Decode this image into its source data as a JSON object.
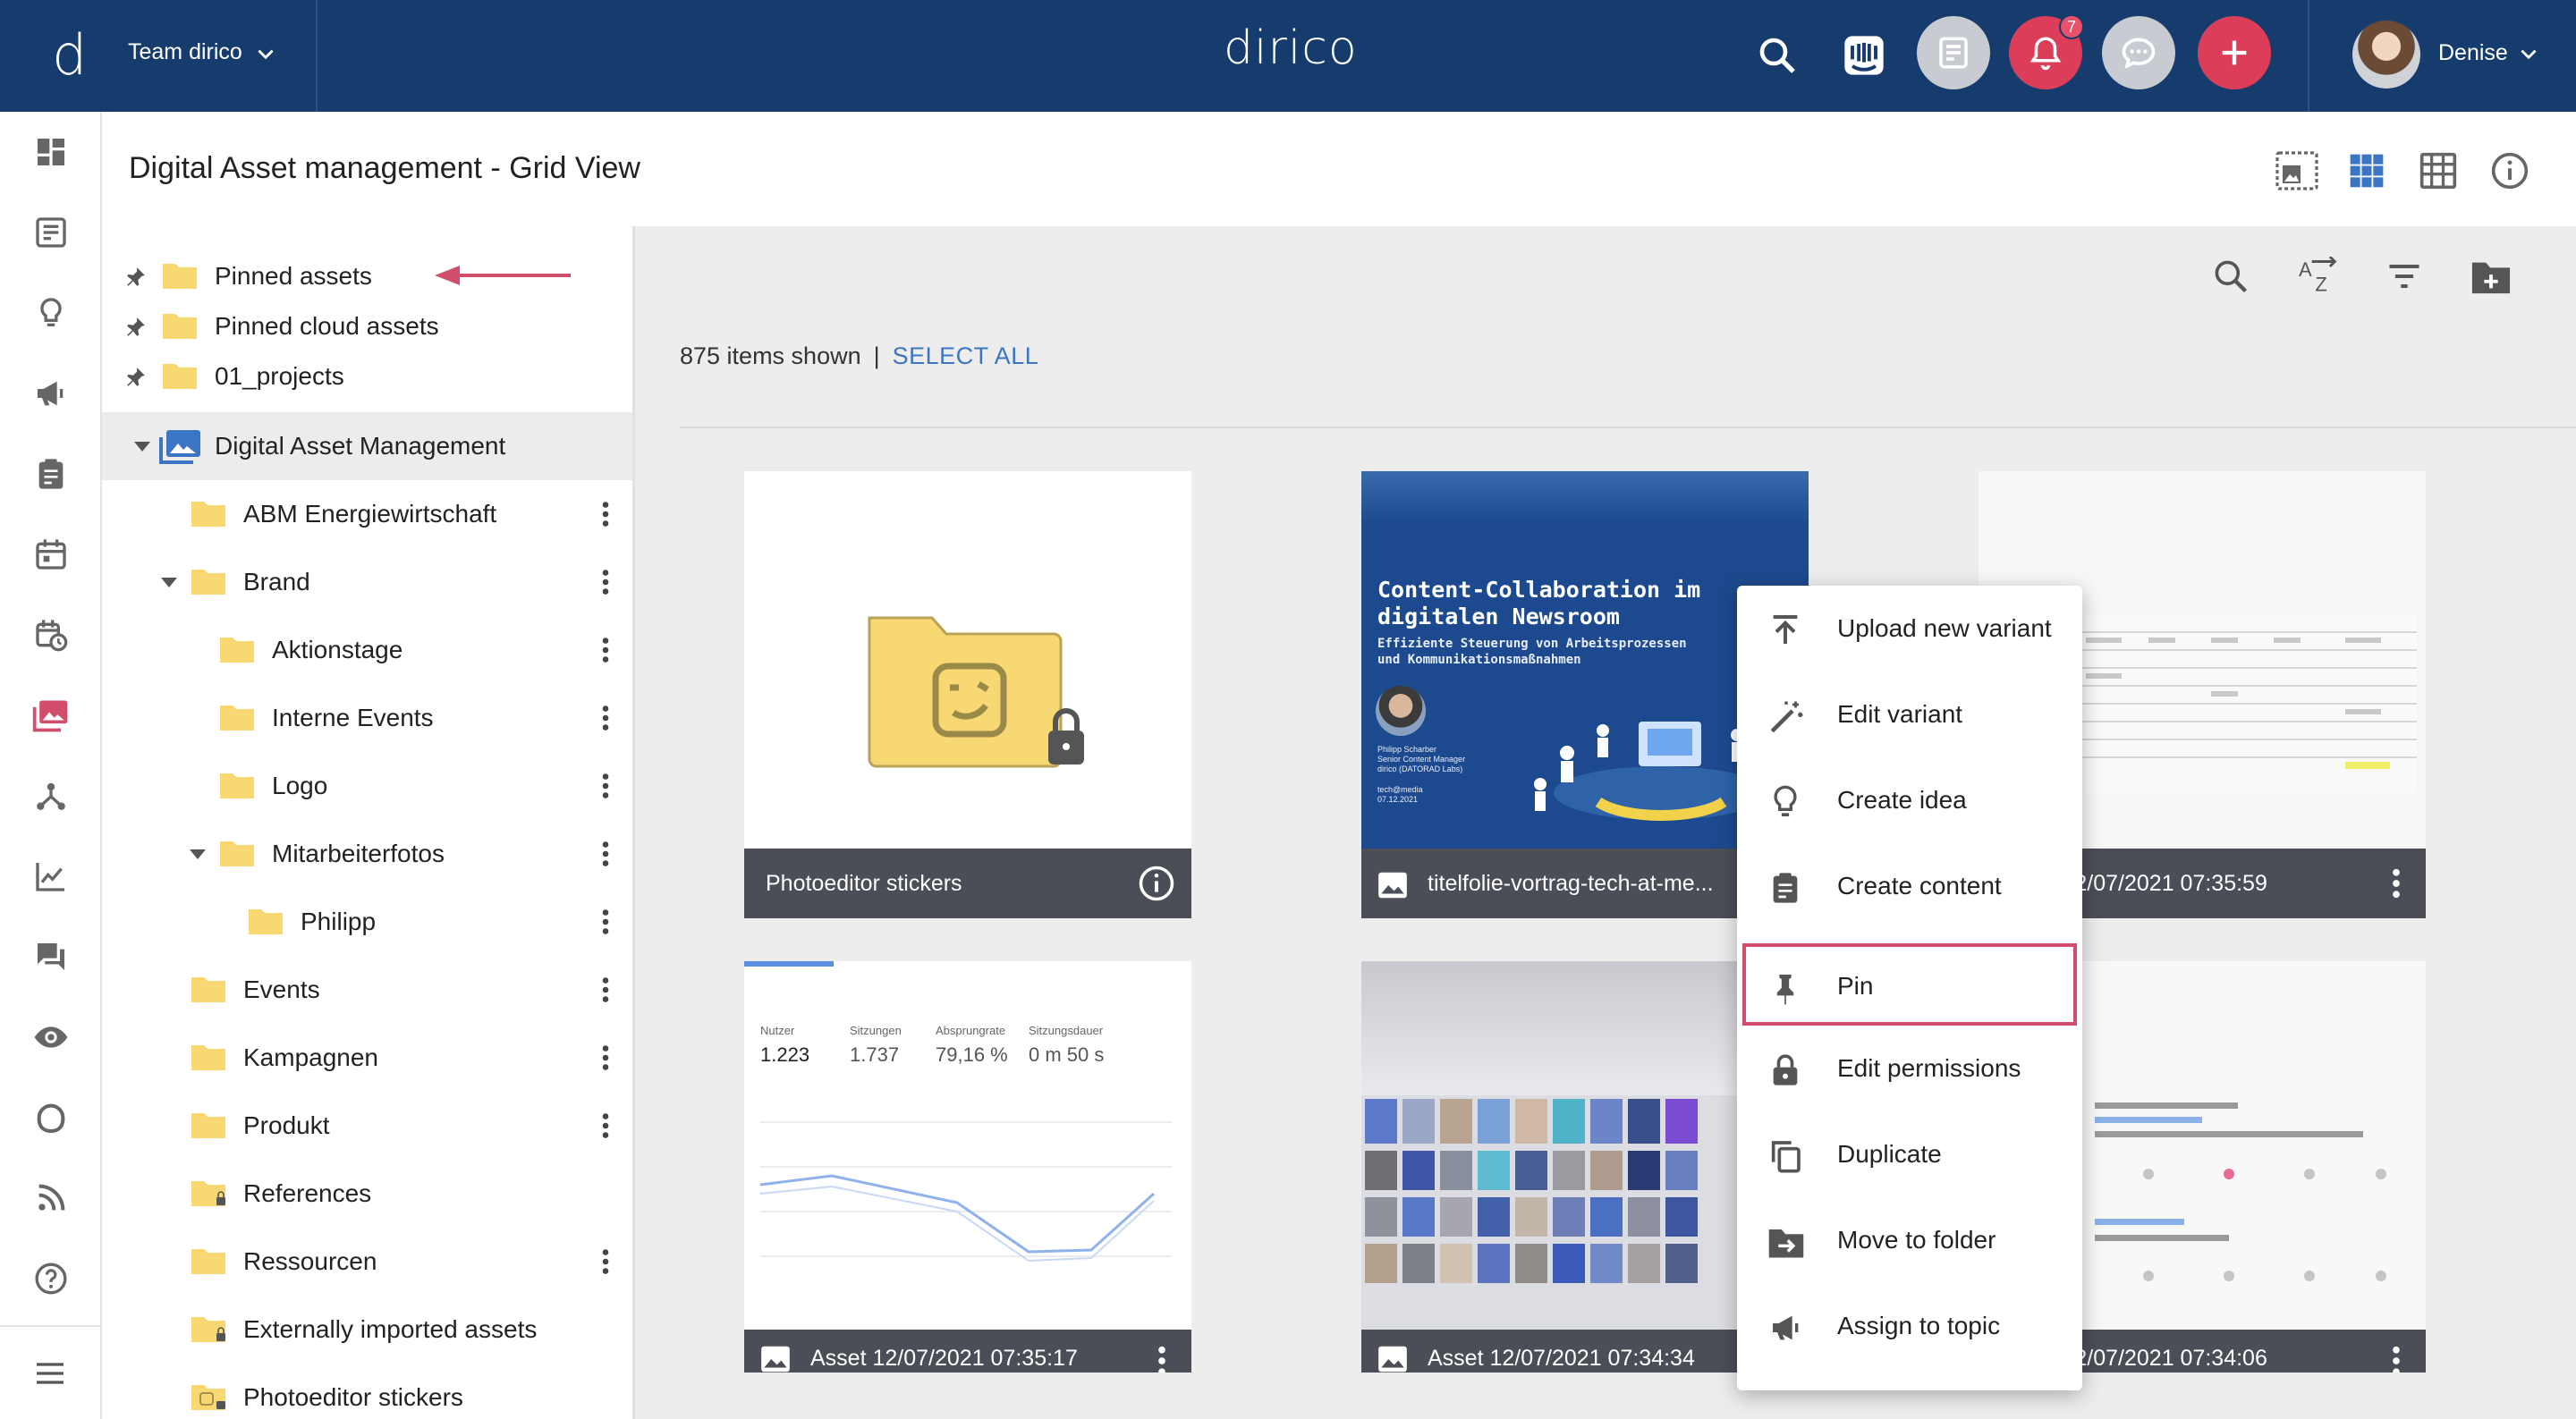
{
  "topbar": {
    "team_name": "Team dirico",
    "app_name": "dirico",
    "notification_count": "7",
    "user_name": "Denise"
  },
  "page": {
    "title": "Digital Asset management - Grid View"
  },
  "tree": {
    "pinned": [
      {
        "label": "Pinned assets"
      },
      {
        "label": "Pinned cloud assets"
      },
      {
        "label": "01_projects"
      }
    ],
    "root": {
      "label": "Digital Asset Management"
    },
    "items": [
      {
        "label": "ABM Energiewirtschaft"
      },
      {
        "label": "Brand"
      },
      {
        "label": "Aktionstage"
      },
      {
        "label": "Interne Events"
      },
      {
        "label": "Logo"
      },
      {
        "label": "Mitarbeiterfotos"
      },
      {
        "label": "Philipp"
      },
      {
        "label": "Events"
      },
      {
        "label": "Kampagnen"
      },
      {
        "label": "Produkt"
      },
      {
        "label": "References"
      },
      {
        "label": "Ressourcen"
      },
      {
        "label": "Externally imported assets"
      },
      {
        "label": "Photoeditor stickers"
      }
    ]
  },
  "main": {
    "items_shown": "875 items shown",
    "separator": "|",
    "select_all": "SELECT ALL",
    "cards": [
      {
        "caption": "Photoeditor stickers"
      },
      {
        "caption": "titelfolie-vortrag-tech-at-me..."
      },
      {
        "caption": "Asset 12/07/2021 07:35:59"
      },
      {
        "caption": "Asset 12/07/2021 07:35:17"
      },
      {
        "caption": "Asset 12/07/2021 07:34:34"
      },
      {
        "caption": "Asset 12/07/2021 07:34:06"
      }
    ],
    "slide": {
      "title_line1": "Content-Collaboration im",
      "title_line2": "digitalen Newsroom",
      "sub_line1": "Effiziente Steuerung von Arbeitsprozessen",
      "sub_line2": "und Kommunikationsmaßnahmen",
      "person_name": "Philipp Scharber",
      "person_role": "Senior Content Manager",
      "person_org": "dirico (DATORAD Labs)",
      "event": "tech@media",
      "date": "07.12.2021"
    },
    "analytics": {
      "labels": [
        "Nutzer",
        "Sitzungen",
        "Absprungrate",
        "Sitzungsdauer"
      ],
      "values": [
        "1.223",
        "1.737",
        "79,16 %",
        "0 m 50 s"
      ]
    }
  },
  "context_menu": {
    "items": [
      {
        "label": "Upload new variant",
        "icon": "upload-icon"
      },
      {
        "label": "Edit variant",
        "icon": "magic-wand-icon"
      },
      {
        "label": "Create idea",
        "icon": "lightbulb-icon"
      },
      {
        "label": "Create content",
        "icon": "clipboard-icon"
      },
      {
        "label": "Pin",
        "icon": "pin-icon"
      },
      {
        "label": "Edit permissions",
        "icon": "lock-icon"
      },
      {
        "label": "Duplicate",
        "icon": "duplicate-icon"
      },
      {
        "label": "Move to folder",
        "icon": "move-to-folder-icon"
      },
      {
        "label": "Assign to topic",
        "icon": "megaphone-icon"
      }
    ]
  },
  "colors": {
    "topbar": "#163c6e",
    "accent_red": "#dc3e5a",
    "link_blue": "#3b75c4",
    "folder_yellow": "#f7d873"
  }
}
